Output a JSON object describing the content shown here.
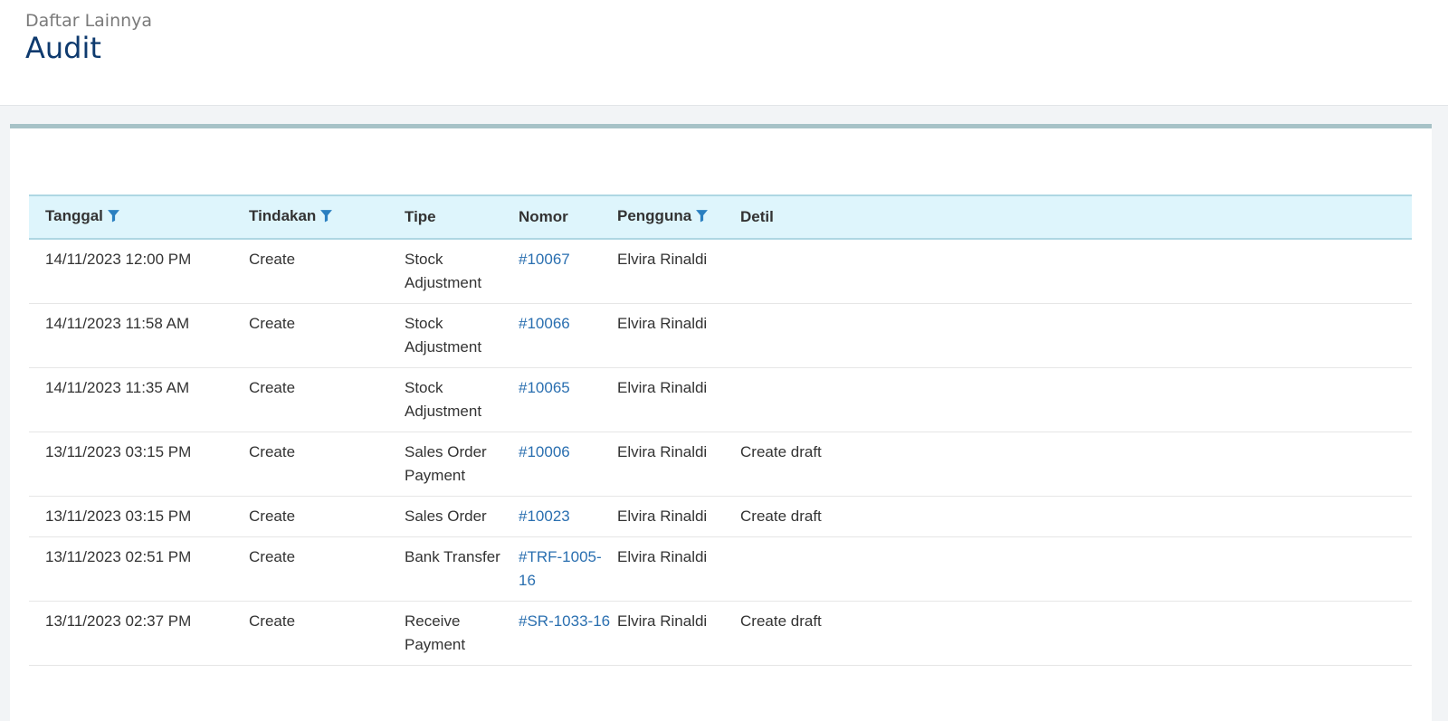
{
  "header": {
    "breadcrumb": "Daftar Lainnya",
    "title": "Audit"
  },
  "table": {
    "columns": [
      "Tanggal",
      "Tindakan",
      "Tipe",
      "Nomor",
      "Pengguna",
      "Detil"
    ],
    "rows": [
      {
        "tanggal": "14/11/2023 12:00 PM",
        "tindakan": "Create",
        "tipe": "Stock Adjustment",
        "nomor": "#10067",
        "pengguna": "Elvira Rinaldi",
        "detil": ""
      },
      {
        "tanggal": "14/11/2023 11:58 AM",
        "tindakan": "Create",
        "tipe": "Stock Adjustment",
        "nomor": "#10066",
        "pengguna": "Elvira Rinaldi",
        "detil": ""
      },
      {
        "tanggal": "14/11/2023 11:35 AM",
        "tindakan": "Create",
        "tipe": "Stock Adjustment",
        "nomor": "#10065",
        "pengguna": "Elvira Rinaldi",
        "detil": ""
      },
      {
        "tanggal": "13/11/2023 03:15 PM",
        "tindakan": "Create",
        "tipe": "Sales Order Payment",
        "nomor": "#10006",
        "pengguna": "Elvira Rinaldi",
        "detil": "Create draft"
      },
      {
        "tanggal": "13/11/2023 03:15 PM",
        "tindakan": "Create",
        "tipe": "Sales Order",
        "nomor": "#10023",
        "pengguna": "Elvira Rinaldi",
        "detil": "Create draft"
      },
      {
        "tanggal": "13/11/2023 02:51 PM",
        "tindakan": "Create",
        "tipe": "Bank Transfer",
        "nomor": "#TRF-1005-16",
        "pengguna": "Elvira Rinaldi",
        "detil": ""
      },
      {
        "tanggal": "13/11/2023 02:37 PM",
        "tindakan": "Create",
        "tipe": "Receive Payment",
        "nomor": "#SR-1033-16",
        "pengguna": "Elvira Rinaldi",
        "detil": "Create draft"
      }
    ]
  },
  "colors": {
    "title": "#0e3a6e",
    "link": "#2a6fb0",
    "header_bg": "#def5fc",
    "filter_icon": "#2a7fc0"
  }
}
